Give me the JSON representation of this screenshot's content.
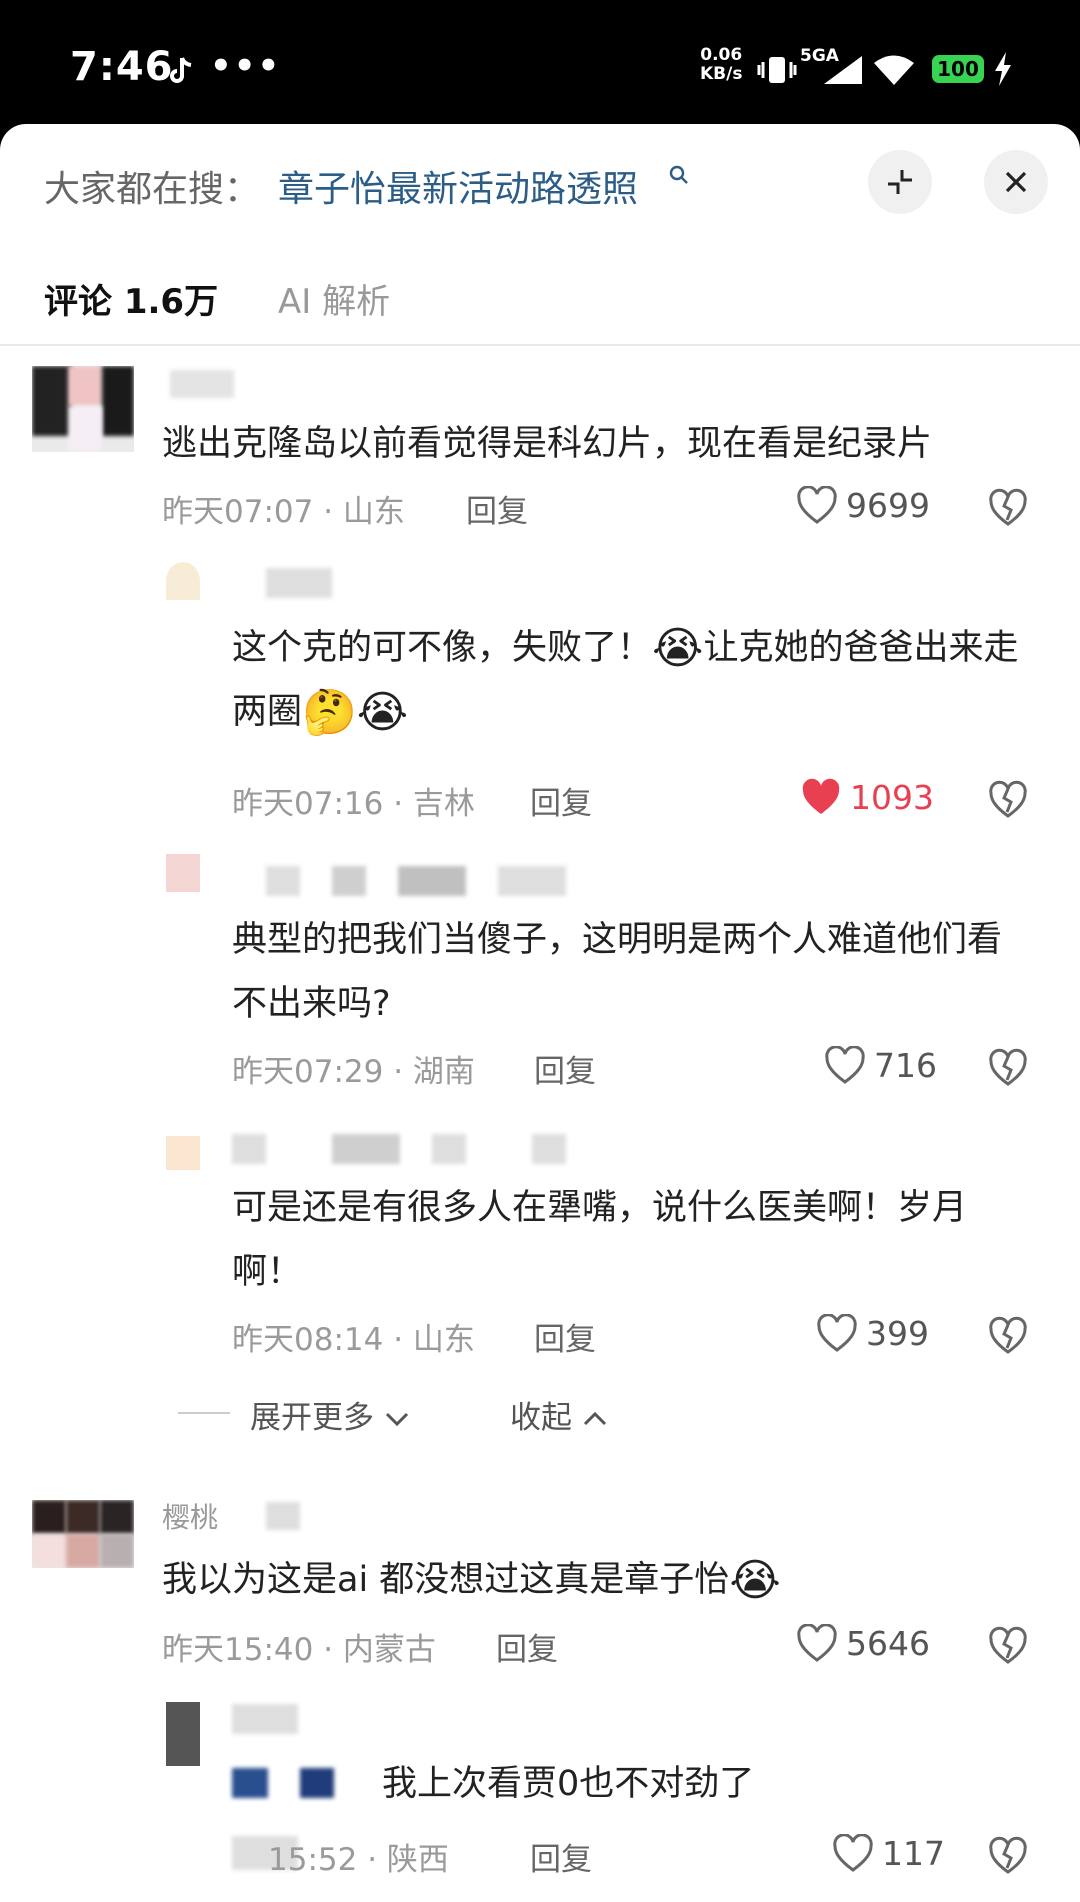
{
  "status_bar": {
    "time": "7:46",
    "more": "•••",
    "net_speed": "0.06",
    "net_speed_unit": "KB/s",
    "network": "5GA",
    "battery": "100"
  },
  "search": {
    "prefix": "大家都在搜：",
    "term": "章子怡最新活动路透照"
  },
  "tabs": {
    "comments": "评论 1.6万",
    "ai": "AI 解析"
  },
  "comments": [
    {
      "text": "逃出克隆岛以前看觉得是科幻片，现在看是纪录片",
      "meta": "昨天07:07 · 山东",
      "reply": "回复",
      "likes": "9699",
      "liked": false
    },
    {
      "text_a": "这个克的可不像，失败了！",
      "emoji_a": "😭",
      "text_b": "让克她的爸爸出来走两圈",
      "emoji_b": "🤔😭",
      "meta": "昨天07:16 · 吉林",
      "reply": "回复",
      "likes": "1093",
      "liked": true
    },
    {
      "text": "典型的把我们当傻子，这明明是两个人难道他们看不出来吗?",
      "meta": "昨天07:29 · 湖南",
      "reply": "回复",
      "likes": "716",
      "liked": false
    },
    {
      "text": "可是还是有很多人在犟嘴，说什么医美啊！岁月啊！",
      "meta": "昨天08:14 · 山东",
      "reply": "回复",
      "likes": "399",
      "liked": false
    },
    {
      "username": "樱桃",
      "text": "我以为这是ai  都没想过这真是章子怡",
      "emoji": "😭",
      "meta": "昨天15:40 · 内蒙古",
      "reply": "回复",
      "likes": "5646",
      "liked": false
    },
    {
      "text": "我上次看贾0也不对劲了",
      "meta": "15:52 · 陕西",
      "reply": "回复",
      "likes": "117",
      "liked": false
    }
  ],
  "thread_controls": {
    "expand_more": "展开更多",
    "collapse": "收起"
  },
  "colors": {
    "accent_link": "#2c5d87",
    "liked": "#e84050",
    "battery": "#39d353"
  }
}
